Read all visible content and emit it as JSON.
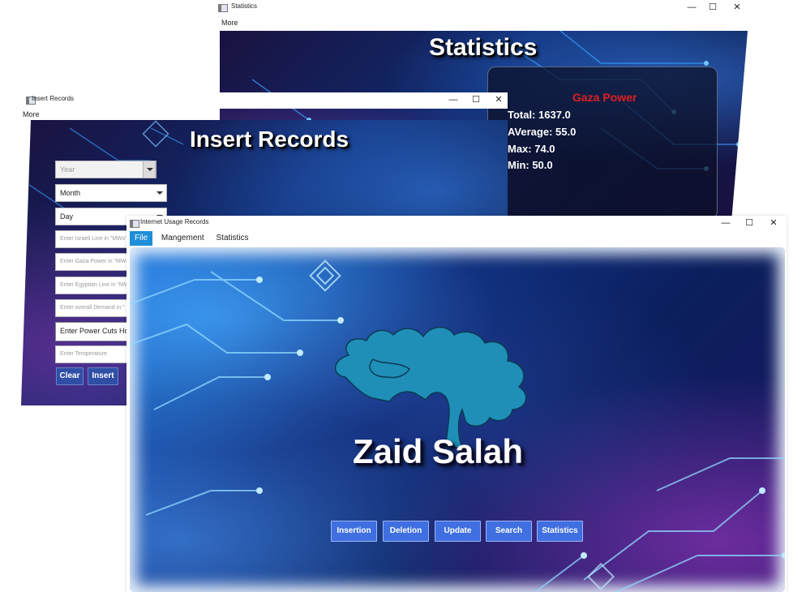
{
  "statistics_window": {
    "title": "Statistics",
    "menu": [
      "More"
    ],
    "banner_title": "Statistics",
    "panel": {
      "heading": "Gaza Power",
      "lines": [
        "Total: 1637.0",
        "AVerage: 55.0",
        "Max: 74.0",
        "Min: 50.0"
      ]
    }
  },
  "insert_window": {
    "title": "Insert Records",
    "menu": [
      "More"
    ],
    "banner_title": "Insert Records",
    "fields": {
      "year": "Year",
      "month": "Month",
      "day": "Day",
      "israeli": "Enter Israeli Line in \"MWs\"",
      "gaza": "Enter Gaza Power in \"MWs\"",
      "egyptian": "Enter Egyptian Line in \"MWs\"",
      "demand": "Enter overall Demand in \"",
      "power_cuts": "Enter Power Cuts Hou",
      "temperature": "Enter Temperature"
    },
    "buttons": {
      "clear": "Clear",
      "insert": "Insert"
    }
  },
  "main_window": {
    "title": "Internet Usage Records",
    "menu": [
      "File",
      "Mangement",
      "Statistics"
    ],
    "active_menu": "File",
    "name": "Zaid Salah",
    "buttons": [
      "Insertion",
      "Deletion",
      "Update",
      "Search",
      "Statistics"
    ]
  },
  "window_controls": {
    "minimize": "—",
    "maximize": "☐",
    "close": "✕"
  },
  "colors": {
    "button": "#3f6fe0",
    "tree": "#1f8fb8",
    "stat_heading": "#e02020",
    "menu_active": "#1e8fd8"
  }
}
